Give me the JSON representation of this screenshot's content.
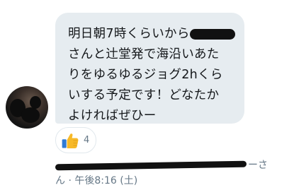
{
  "message": {
    "lines": [
      "明日朝7時くらいから",
      "さんと辻堂発で海沿いあた",
      "りをゆるゆるジョグ2hくら",
      "いする予定です！どなたか",
      "よければぜひー"
    ]
  },
  "reaction": {
    "emoji": "thumbs-up-icon",
    "count": "4"
  },
  "meta": {
    "name_tail": "ーさ",
    "line2": "ん · 午後8:16 (土)"
  },
  "colors": {
    "bubble": "#e6ecf0",
    "meta_text": "#657786",
    "thumb": "#f7b928"
  }
}
